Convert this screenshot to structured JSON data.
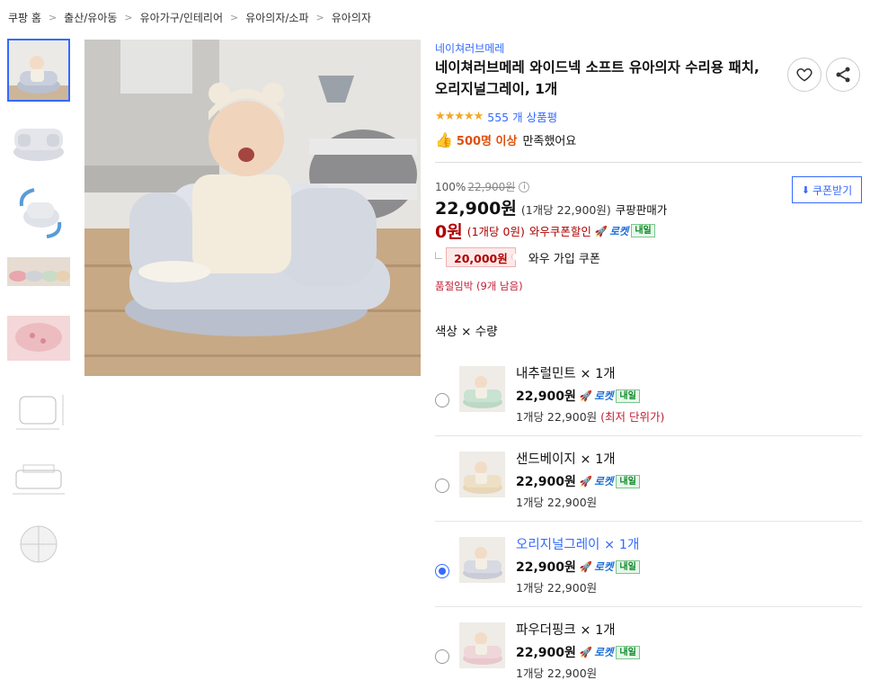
{
  "breadcrumb": [
    "쿠팡 홈",
    "출산/유아동",
    "유아가구/인테리어",
    "유아의자/소파",
    "유아의자"
  ],
  "thumbnails": [
    {
      "name": "baby-seat-photo"
    },
    {
      "name": "seat-shape"
    },
    {
      "name": "seat-rotation"
    },
    {
      "name": "seat-lineup"
    },
    {
      "name": "pink-closeup"
    },
    {
      "name": "dimension-diagram-1"
    },
    {
      "name": "dimension-diagram-2"
    },
    {
      "name": "dimension-diagram-3"
    }
  ],
  "product": {
    "brand": "네이쳐러브메레",
    "title": "네이쳐러브메레 와이드넥 소프트 유아의자 수리용 패치, 오리지널그레이, 1개",
    "stars": "★★★★★",
    "rating_count": "555 개 상품평",
    "satisfaction_highlight": "500명 이상",
    "satisfaction_text": "만족했어요"
  },
  "price": {
    "discount_rate": "100%",
    "original_price": "22,900원",
    "sale_price": "22,900원",
    "sale_unit": "(1개당 22,900원)",
    "sale_label": "쿠팡판매가",
    "wow_price": "0원",
    "wow_unit": "(1개당 0원)",
    "wow_label": "와우쿠폰할인",
    "rocket_label": "로켓",
    "rocket_badge": "내일",
    "coupon_amount": "20,000원",
    "coupon_label": "와우 가입 쿠폰",
    "coupon_button": "쿠폰받기",
    "stock_warning": "품절임박 (9개 남음)"
  },
  "options": {
    "heading": "색상 × 수량",
    "items": [
      {
        "name": "내추럴민트",
        "qty": "× 1개",
        "price": "22,900원",
        "unit": "1개당 22,900원",
        "note": "(최저 단위가)",
        "selected": false,
        "color": "#bcd9c5"
      },
      {
        "name": "샌드베이지",
        "qty": "× 1개",
        "price": "22,900원",
        "unit": "1개당 22,900원",
        "note": "",
        "selected": false,
        "color": "#e8d6b6"
      },
      {
        "name": "오리지널그레이",
        "qty": "× 1개",
        "price": "22,900원",
        "unit": "1개당 22,900원",
        "note": "",
        "selected": true,
        "color": "#c9ccd6"
      },
      {
        "name": "파우더핑크",
        "qty": "× 1개",
        "price": "22,900원",
        "unit": "1개당 22,900원",
        "note": "",
        "selected": false,
        "color": "#e9c8cc"
      }
    ]
  },
  "colors": {
    "accent": "#346aff",
    "price_red": "#ae0000",
    "rocket_blue": "#1b6dd6",
    "star": "#f5a623"
  }
}
